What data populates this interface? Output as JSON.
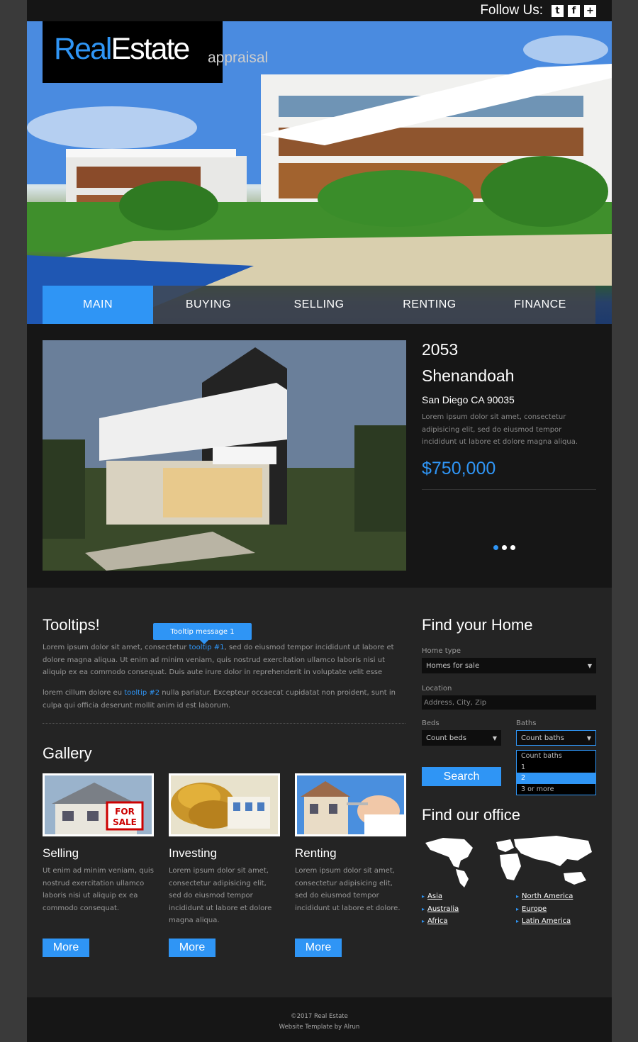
{
  "header": {
    "follow_label": "Follow Us:",
    "social": [
      "twitter-icon",
      "facebook-icon",
      "plus-icon"
    ],
    "social_glyphs": [
      "t",
      "f",
      "+"
    ]
  },
  "logo": {
    "real": "Real",
    "estate": "Estate",
    "tagline": "appraisal"
  },
  "nav": {
    "items": [
      "MAIN",
      "BUYING",
      "SELLING",
      "RENTING",
      "FINANCE"
    ],
    "active": "MAIN"
  },
  "featured": {
    "number": "2053",
    "street": "Shenandoah",
    "city": "San Diego CA 90035",
    "description": "Lorem ipsum dolor sit amet, consectetur adipisicing elit, sed do eiusmod tempor incididunt ut labore et dolore magna aliqua.",
    "price": "$750,000",
    "slides": 3,
    "current_slide": 1
  },
  "tooltips": {
    "title": "Tooltips!",
    "tooltip_text": "Tooltip message 1",
    "p1_a": "Lorem ipsum dolor sit amet, consectetur ",
    "p1_link": "tooltip #1",
    "p1_b": ", sed do eiusmod tempor incididunt ut labore et dolore magna aliqua. Ut enim ad minim veniam, quis nostrud exercitation ullamco laboris nisi ut aliquip ex ea commodo consequat. Duis aute irure dolor in reprehenderit in voluptate velit esse",
    "p2_a": "lorem cillum dolore eu ",
    "p2_link": "tooltip #2",
    "p2_b": " nulla pariatur. Excepteur occaecat cupidatat non proident, sunt in culpa qui officia deserunt mollit anim id est laborum."
  },
  "gallery": {
    "title": "Gallery",
    "items": [
      {
        "title": "Selling",
        "text": "Ut enim ad minim veniam, quis nostrud exercitation ullamco laboris nisi ut aliquip ex ea commodo consequat.",
        "button": "More",
        "sign": "FOR SALE"
      },
      {
        "title": "Investing",
        "text": "Lorem ipsum dolor sit amet, consectetur adipisicing elit, sed do eiusmod tempor incididunt ut labore et dolore magna aliqua.",
        "button": "More"
      },
      {
        "title": "Renting",
        "text": "Lorem ipsum dolor sit amet, consectetur adipisicing elit, sed do eiusmod tempor incididunt ut labore et dolore.",
        "button": "More"
      }
    ]
  },
  "search": {
    "title": "Find your Home",
    "home_type_label": "Home type",
    "home_type_value": "Homes for sale",
    "location_label": "Location",
    "location_placeholder": "Address, City, Zip",
    "beds_label": "Beds",
    "beds_value": "Count beds",
    "baths_label": "Baths",
    "baths_value": "Count baths",
    "baths_options": [
      "Count baths",
      "1",
      "2",
      "3 or more"
    ],
    "baths_highlighted": "2",
    "button": "Search"
  },
  "office": {
    "title": "Find our office",
    "links_left": [
      "Asia",
      "Australia",
      "Africa"
    ],
    "links_right": [
      "North America",
      "Europe",
      "Latin America"
    ]
  },
  "footer": {
    "copyright": "©2017 Real Estate",
    "credit": "Website Template by Alrun"
  },
  "colors": {
    "accent": "#2f95f5",
    "background": "#1c1c1c",
    "panel": "#242424"
  }
}
